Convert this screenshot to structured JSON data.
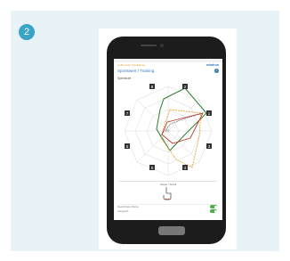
{
  "step": {
    "number": "2"
  },
  "app": {
    "breadcrumb": "◂ Übersicht Spielklasse",
    "brand": "rebatron",
    "title": "Sportswert / Training",
    "section_label": "Spielstufe",
    "info_icon": "i",
    "radar_labels": [
      "2",
      "3",
      "4",
      "5",
      "6",
      "7",
      "8",
      "1"
    ],
    "center_label": "AT",
    "series_colors": [
      "#2f7d32",
      "#e8a33a",
      "#c0392b",
      "#555555"
    ],
    "gesture_label": "Swipe / Scroll",
    "gesture_icon": "hand-pointer-icon",
    "toggle_rows": [
      {
        "label": "Gewichtete Werte",
        "on": true
      },
      {
        "label": "Vergleich",
        "on": true
      }
    ],
    "pager": {
      "pages": 2,
      "active": 1
    }
  }
}
